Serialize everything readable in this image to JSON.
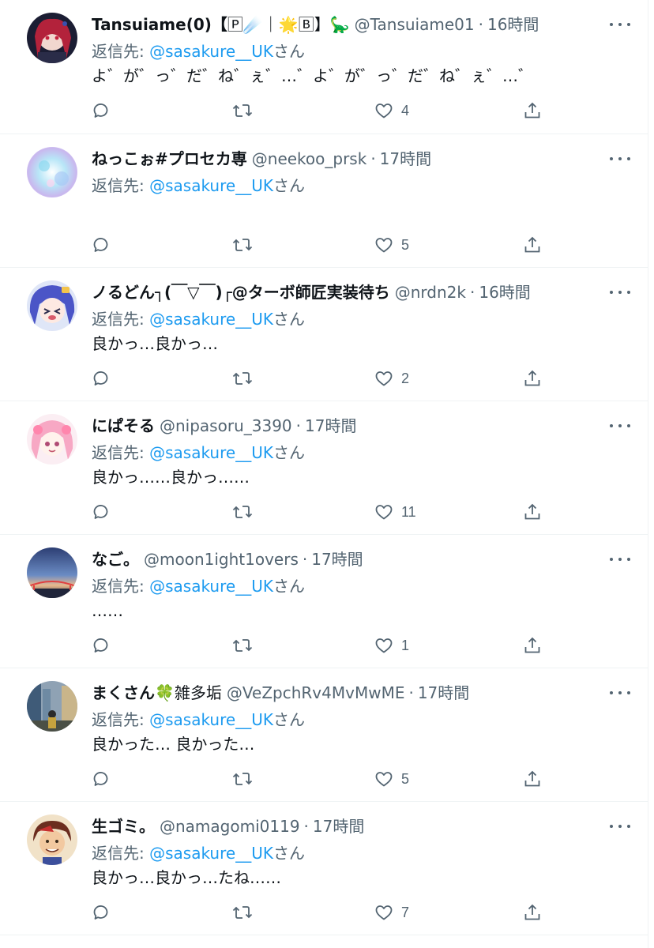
{
  "colors": {
    "mention": "#1d9bf0",
    "secondary_text": "#536471",
    "primary_text": "#0f1419",
    "divider": "#eff3f4"
  },
  "icons": {
    "reply": "reply-icon",
    "retweet": "retweet-icon",
    "like": "heart-icon",
    "share": "share-icon",
    "more": "more-icon"
  },
  "tweets": [
    {
      "display_name": "Tansuiame(0)【",
      "name_emoji": "🄿☄️｜🌟🄱】🦕",
      "handle": "@Tansuiame01",
      "time": "16時間",
      "reply_label": "返信先: ",
      "reply_mention": "@sasakure__UK",
      "reply_suffix": "さん",
      "text": "よ゛が゛っ゛だ゛ね゛ぇ゛…゛よ゛が゛っ゛だ゛ね゛ぇ゛…゛",
      "likes": "4"
    },
    {
      "display_name": "ねっこぉ#プロセカ専",
      "name_emoji": "",
      "handle": "@neekoo_prsk",
      "time": "17時間",
      "reply_label": "返信先: ",
      "reply_mention": "@sasakure__UK",
      "reply_suffix": "さん",
      "text": "",
      "likes": "5"
    },
    {
      "display_name": "ノるどん┐(￣▽￣)┌@ターボ師匠実装待ち",
      "name_emoji": "",
      "handle": "@nrdn2k",
      "time": "16時間",
      "reply_label": "返信先: ",
      "reply_mention": "@sasakure__UK",
      "reply_suffix": "さん",
      "text": "良かっ…良かっ…",
      "likes": "2"
    },
    {
      "display_name": "にぱそる",
      "name_emoji": "",
      "handle": "@nipasoru_3390",
      "time": "17時間",
      "reply_label": "返信先: ",
      "reply_mention": "@sasakure__UK",
      "reply_suffix": "さん",
      "text": "良かっ……良かっ……",
      "likes": "11"
    },
    {
      "display_name": "なご。",
      "name_emoji": "",
      "handle": "@moon1ight1overs",
      "time": "17時間",
      "reply_label": "返信先: ",
      "reply_mention": "@sasakure__UK",
      "reply_suffix": "さん",
      "text": "……",
      "likes": "1"
    },
    {
      "display_name": "まくさん",
      "name_emoji": "🍀雑多垢",
      "handle": "@VeZpchRv4MvMwME",
      "time": "17時間",
      "reply_label": "返信先: ",
      "reply_mention": "@sasakure__UK",
      "reply_suffix": "さん",
      "text": "良かった… 良かった…",
      "likes": "5"
    },
    {
      "display_name": "生ゴミ。",
      "name_emoji": "",
      "handle": "@namagomi0119",
      "time": "17時間",
      "reply_label": "返信先: ",
      "reply_mention": "@sasakure__UK",
      "reply_suffix": "さん",
      "text": "良かっ…良かっ…たね……",
      "likes": "7"
    }
  ]
}
